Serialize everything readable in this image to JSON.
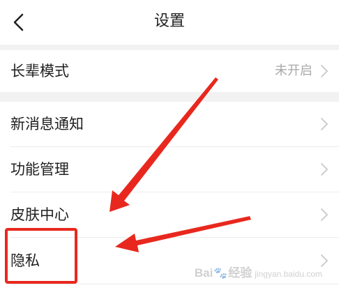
{
  "header": {
    "title": "设置",
    "back_icon": "chevron-left-icon"
  },
  "settings": {
    "elder_mode": {
      "label": "长辈模式",
      "value": "未开启"
    },
    "new_message_notify": {
      "label": "新消息通知"
    },
    "feature_manage": {
      "label": "功能管理"
    },
    "skin_center": {
      "label": "皮肤中心"
    },
    "privacy": {
      "label": "隐私"
    }
  },
  "annotation": {
    "arrow_color": "#e8281e",
    "box_color": "#e8281e"
  },
  "watermark": {
    "brand_a": "Bai",
    "brand_b": "经验",
    "brand_sub": "jingyan.baidu.com"
  },
  "colors": {
    "background": "#ffffff",
    "group_gap": "#f2f2f2",
    "text": "#1f1f1f",
    "secondary_text": "#a8a8a8",
    "chevron": "#c8c8c8"
  }
}
